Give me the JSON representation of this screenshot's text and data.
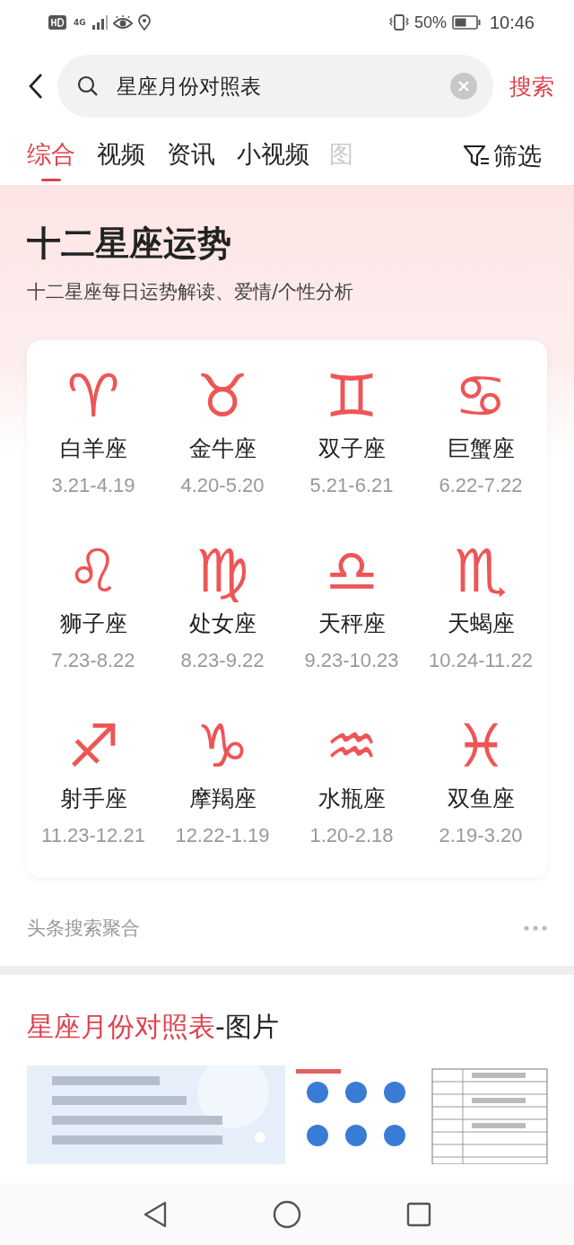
{
  "status_bar": {
    "network": "4G",
    "battery": "50%",
    "time": "10:46"
  },
  "search": {
    "value": "星座月份对照表",
    "button": "搜索"
  },
  "tabs": [
    {
      "label": "综合",
      "selected": true
    },
    {
      "label": "视频",
      "selected": false
    },
    {
      "label": "资讯",
      "selected": false
    },
    {
      "label": "小视频",
      "selected": false
    },
    {
      "label": "图",
      "selected": false
    }
  ],
  "filter": "筛选",
  "card": {
    "title": "十二星座运势",
    "subtitle": "十二星座每日运势解读、爱情/个性分析",
    "signs": [
      {
        "symbol": "♈",
        "name": "白羊座",
        "dates": "3.21-4.19"
      },
      {
        "symbol": "♉",
        "name": "金牛座",
        "dates": "4.20-5.20"
      },
      {
        "symbol": "♊",
        "name": "双子座",
        "dates": "5.21-6.21"
      },
      {
        "symbol": "♋",
        "name": "巨蟹座",
        "dates": "6.22-7.22"
      },
      {
        "symbol": "♌",
        "name": "狮子座",
        "dates": "7.23-8.22"
      },
      {
        "symbol": "♍",
        "name": "处女座",
        "dates": "8.23-9.22"
      },
      {
        "symbol": "♎",
        "name": "天秤座",
        "dates": "9.23-10.23"
      },
      {
        "symbol": "♏",
        "name": "天蝎座",
        "dates": "10.24-11.22"
      },
      {
        "symbol": "♐",
        "name": "射手座",
        "dates": "11.23-12.21"
      },
      {
        "symbol": "♑",
        "name": "摩羯座",
        "dates": "12.22-1.19"
      },
      {
        "symbol": "♒",
        "name": "水瓶座",
        "dates": "1.20-2.18"
      },
      {
        "symbol": "♓",
        "name": "双鱼座",
        "dates": "2.19-3.20"
      }
    ],
    "source": "头条搜索聚合"
  },
  "images_section": {
    "title_highlight": "星座月份对照表",
    "title_rest": "-图片"
  }
}
